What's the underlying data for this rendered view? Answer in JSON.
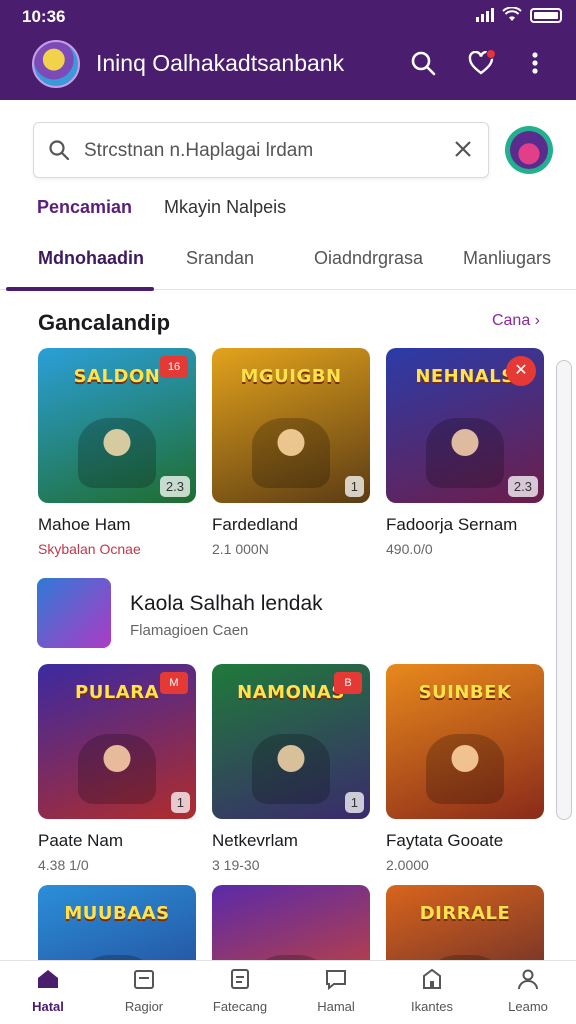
{
  "status_bar": {
    "time": "10:36"
  },
  "app_bar": {
    "title": "Ininq Oalhakadtsanbank",
    "icons": [
      "avatar-icon",
      "search-icon",
      "heart-icon",
      "more-icon"
    ]
  },
  "search": {
    "placeholder": "Strcstnan n.Haplagai lrdam",
    "icon": "search-icon",
    "clear_icon": "close-icon"
  },
  "chips": [
    "Pencamian",
    "Mkayin Nalpeis"
  ],
  "tabs": [
    "Mdnohaadin",
    "Srandan",
    "Oiadndrgrasa",
    "Manliugars"
  ],
  "section": {
    "title": "Gancalandip",
    "see_all": "Cana"
  },
  "row1": [
    {
      "banner": "SALDON",
      "pill": "2.3",
      "corner": "tag",
      "corner_text": "16",
      "title": "Mahoe Ham",
      "sub": "Skybalan Ocnae",
      "sub_red": true,
      "colors": [
        "#2b9fd8",
        "#1f6d2e"
      ]
    },
    {
      "banner": "MGUIGBN",
      "pill": "1",
      "corner": "",
      "corner_text": "",
      "title": "Fardedland",
      "sub": "2.1 000N",
      "sub_red": false,
      "colors": [
        "#e3a31c",
        "#5b3b14"
      ]
    },
    {
      "banner": "NEHNALS",
      "pill": "2.3",
      "corner": "fav",
      "corner_text": "✕",
      "title": "Fadoorja Sernam",
      "sub": "490.0/0",
      "sub_red": false,
      "colors": [
        "#2b3ca8",
        "#6d1d4a"
      ]
    }
  ],
  "feature": {
    "title": "Kaola Salhah lendak",
    "sub": "Flamagioen Caen"
  },
  "row2": [
    {
      "banner": "PULARA",
      "pill": "1",
      "corner": "tag",
      "corner_text": "M",
      "title": "Paate Nam",
      "sub": "4.38 1/0",
      "sub_red": false,
      "colors": [
        "#3b2aa1",
        "#b02c2c"
      ]
    },
    {
      "banner": "NAMONAS",
      "pill": "1",
      "corner": "tag",
      "corner_text": "B",
      "title": "Netkevrlam",
      "sub": "3 19-30",
      "sub_red": false,
      "colors": [
        "#1f7a3a",
        "#3b2a6d"
      ]
    },
    {
      "banner": "SUINBEK",
      "pill": "",
      "corner": "",
      "corner_text": "",
      "title": "Faytata Gooate",
      "sub": "2.0000",
      "sub_red": false,
      "colors": [
        "#e8891c",
        "#8a2a1a"
      ]
    }
  ],
  "row3": [
    {
      "banner": "MUUBAAS",
      "colors": [
        "#2b8fd8",
        "#223a8a"
      ]
    },
    {
      "banner": "",
      "colors": [
        "#5a2aa8",
        "#e24a1c"
      ]
    },
    {
      "banner": "DIRRALE",
      "colors": [
        "#d8651c",
        "#4a1d2e"
      ]
    }
  ],
  "bottom_nav": [
    {
      "label": "Hatal",
      "icon": "home-icon",
      "active": true
    },
    {
      "label": "Ragior",
      "icon": "calendar-icon",
      "active": false
    },
    {
      "label": "Fatecang",
      "icon": "document-icon",
      "active": false
    },
    {
      "label": "Hamal",
      "icon": "chat-icon",
      "active": false
    },
    {
      "label": "Ikantes",
      "icon": "building-icon",
      "active": false
    },
    {
      "label": "Leamo",
      "icon": "person-icon",
      "active": false
    }
  ],
  "colors": {
    "primary": "#4a1d6e",
    "accent": "#8a2a9a",
    "badge": "#e8333b"
  }
}
